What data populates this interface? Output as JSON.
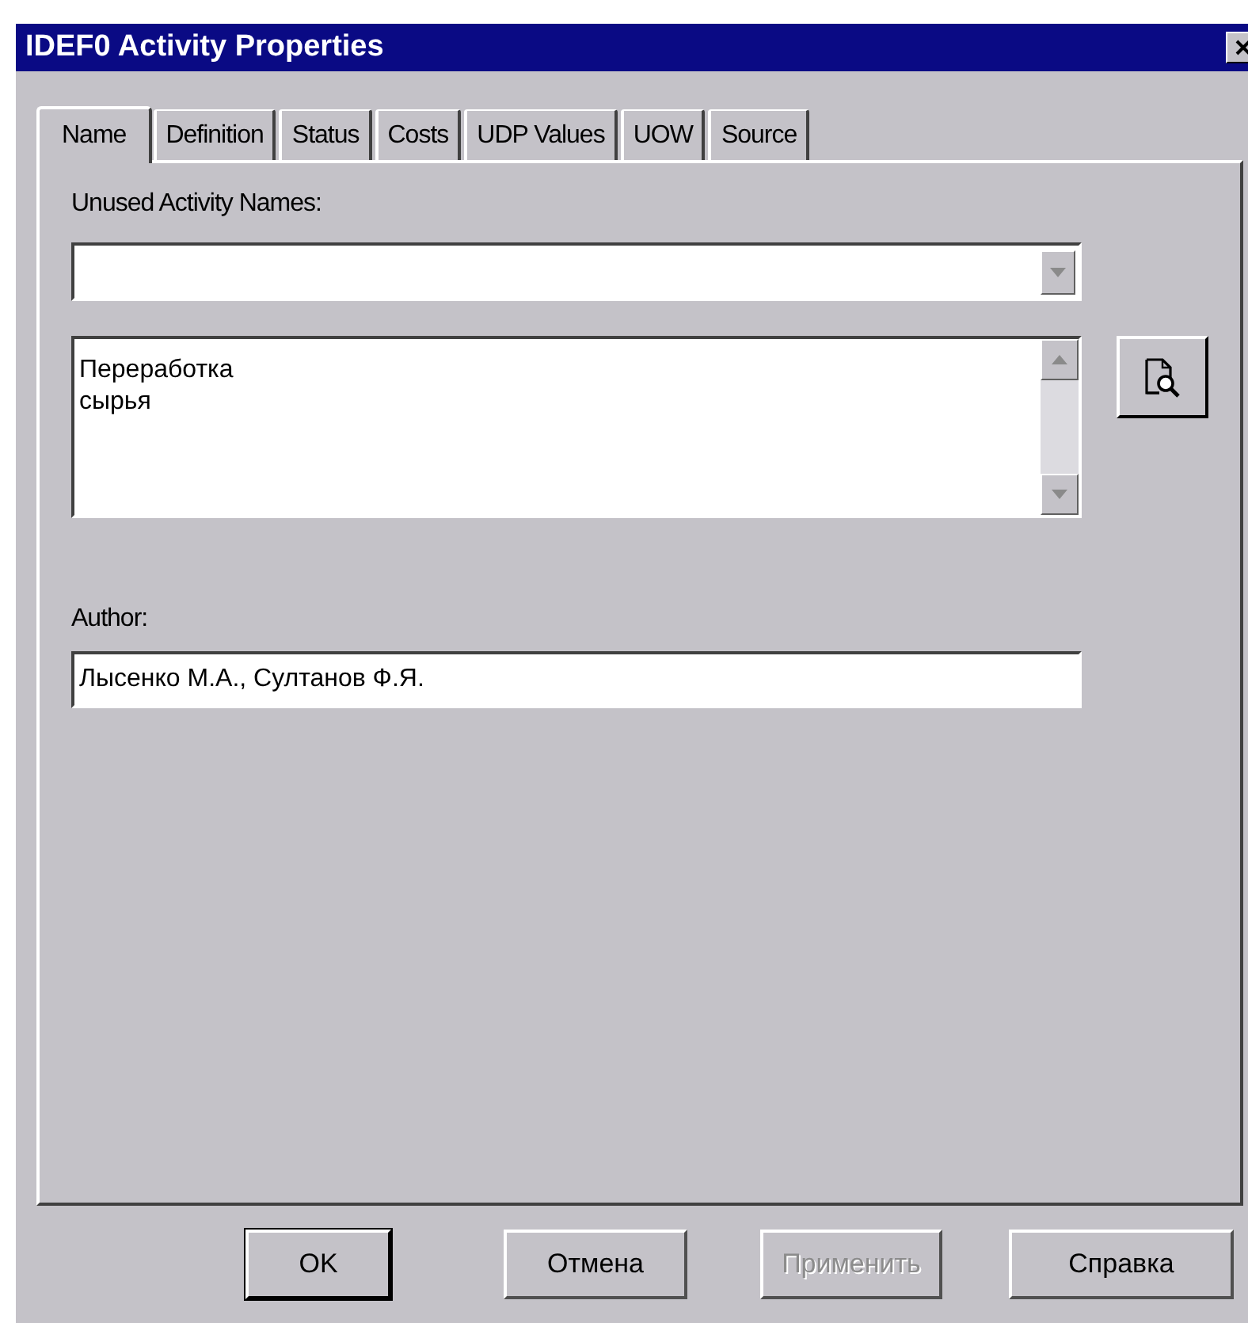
{
  "window": {
    "title": "IDEF0 Activity Properties"
  },
  "tabs": [
    {
      "label": "Name",
      "selected": true
    },
    {
      "label": "Definition",
      "selected": false
    },
    {
      "label": "Status",
      "selected": false
    },
    {
      "label": "Costs",
      "selected": false
    },
    {
      "label": "UDP Values",
      "selected": false
    },
    {
      "label": "UOW",
      "selected": false
    },
    {
      "label": "Source",
      "selected": false
    }
  ],
  "unused_names": {
    "label": "Unused Activity Names:"
  },
  "name_text": {
    "lines": [
      "Переработка",
      "сырья"
    ]
  },
  "author": {
    "label": "Author:",
    "value": "Лысенко М.А., Султанов Ф.Я."
  },
  "buttons": [
    {
      "label": "OK",
      "default": true,
      "disabled": false
    },
    {
      "label": "Отмена",
      "default": false,
      "disabled": false
    },
    {
      "label": "Применить",
      "default": false,
      "disabled": true
    },
    {
      "label": "Справка",
      "default": false,
      "disabled": false
    }
  ]
}
